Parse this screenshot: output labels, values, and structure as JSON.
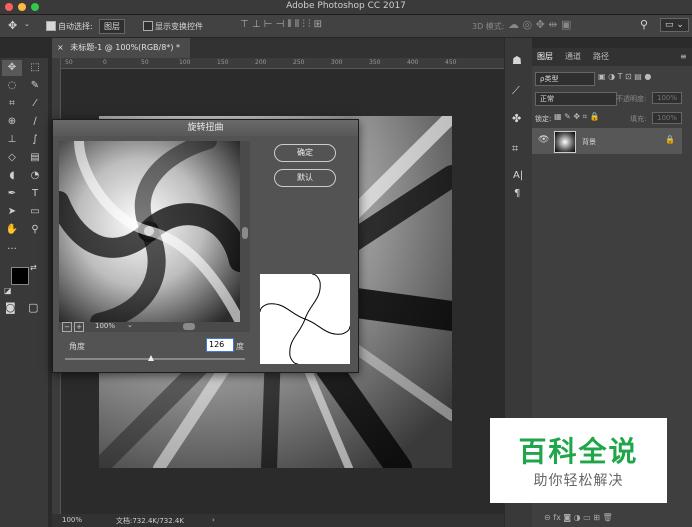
{
  "app": {
    "title": "Adobe Photoshop CC 2017"
  },
  "options_bar": {
    "auto_select_label": "自动选择:",
    "auto_select_value": "图层",
    "show_transform_label": "显示变换控件",
    "mode_3d_label": "3D 模式:"
  },
  "document": {
    "tab_label": "未标题-1 @ 100%(RGB/8*) *"
  },
  "ruler": {
    "ticks": [
      "50",
      "0",
      "50",
      "100",
      "150",
      "200",
      "250",
      "300",
      "350",
      "400",
      "450"
    ]
  },
  "dialog": {
    "title": "旋转扭曲",
    "ok_label": "确定",
    "default_label": "默认",
    "zoom_value": "100%",
    "angle_label": "角度",
    "angle_value": "126",
    "angle_unit": "度",
    "slider_level_pct": 48
  },
  "layers_panel": {
    "tabs": [
      "图层",
      "通道",
      "路径"
    ],
    "filter_placeholder": "ρ类型",
    "blend_mode": "正常",
    "opacity_label": "不透明度:",
    "opacity_value": "100%",
    "lock_label": "锁定:",
    "fill_label": "填充:",
    "fill_value": "100%",
    "layer_name": "背景"
  },
  "status": {
    "zoom": "100%",
    "doc_size": "文档:732.4K/732.4K"
  },
  "watermark": {
    "title": "百科全说",
    "subtitle": "助你轻松解决"
  },
  "colors": {
    "accent_green": "#1fa64a",
    "dialog_bg": "#535353",
    "panel_bg": "#3f3f3f"
  }
}
